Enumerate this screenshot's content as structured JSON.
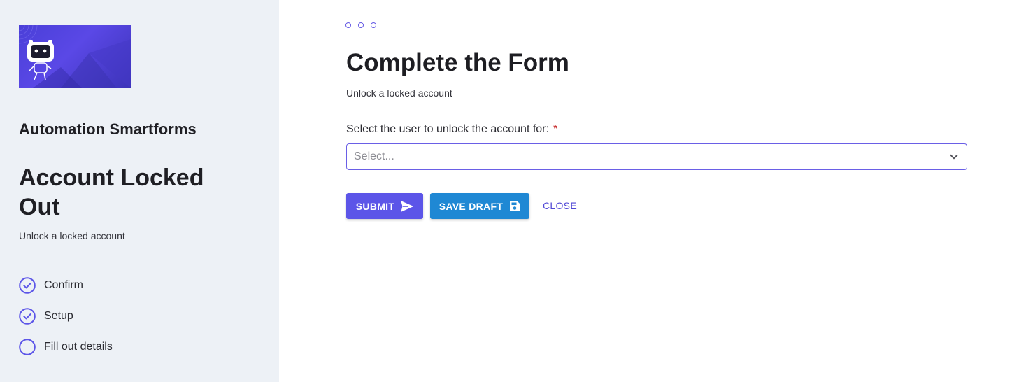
{
  "sidebar": {
    "brand": "Automation Smartforms",
    "title": "Account Locked Out",
    "subtitle": "Unlock a locked account",
    "steps": [
      {
        "label": "Confirm",
        "status": "complete"
      },
      {
        "label": "Setup",
        "status": "complete"
      },
      {
        "label": "Fill out details",
        "status": "current"
      }
    ]
  },
  "main": {
    "title": "Complete the Form",
    "subtitle": "Unlock a locked account",
    "field": {
      "label": "Select the user to unlock the account for:",
      "required_mark": "*",
      "placeholder": "Select..."
    },
    "actions": {
      "submit": "SUBMIT",
      "save_draft": "SAVE DRAFT",
      "close": "CLOSE"
    }
  },
  "colors": {
    "accent": "#5c55e8",
    "draft": "#1f88d4",
    "sidebar_bg": "#edf1f6"
  }
}
